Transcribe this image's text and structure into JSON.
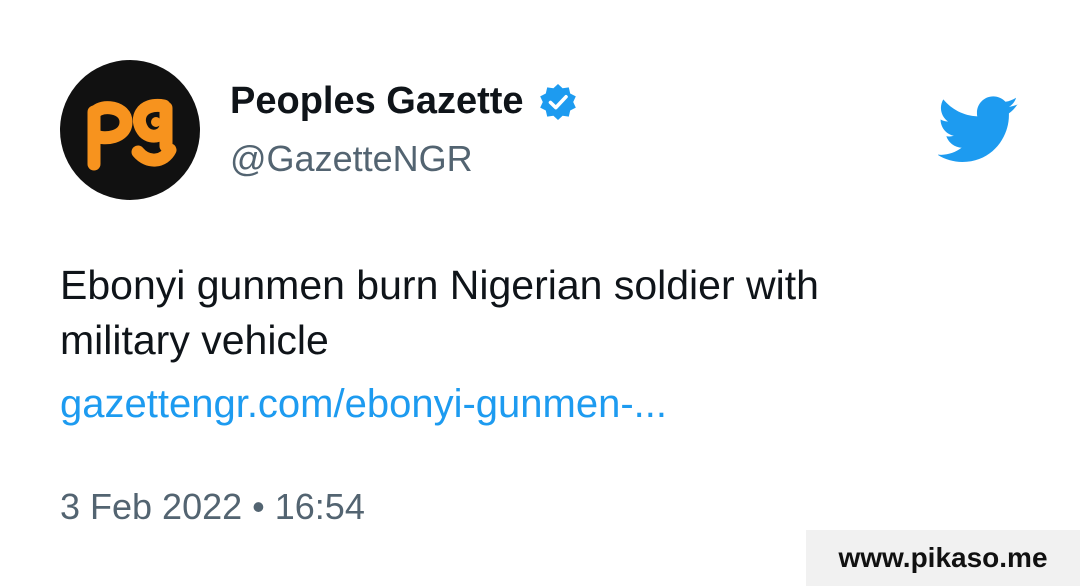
{
  "account": {
    "display_name": "Peoples Gazette",
    "handle": "@GazetteNGR",
    "avatar_text": "pg",
    "verified": true
  },
  "tweet": {
    "text": "Ebonyi gunmen burn Nigerian soldier with military vehicle",
    "link": "gazettengr.com/ebonyi-gunmen-...",
    "timestamp": "3 Feb 2022 • 16:54"
  },
  "icons": {
    "avatar": "peoples-gazette-logo",
    "verified": "verified-badge-icon",
    "platform": "twitter-bird-icon"
  },
  "colors": {
    "accent": "#1d9bf0",
    "avatar_bg": "#111111",
    "logo_orange": "#f7931e",
    "text_primary": "#0f1419",
    "text_secondary": "#536471"
  },
  "watermark": {
    "text": "www.pikaso.me"
  }
}
